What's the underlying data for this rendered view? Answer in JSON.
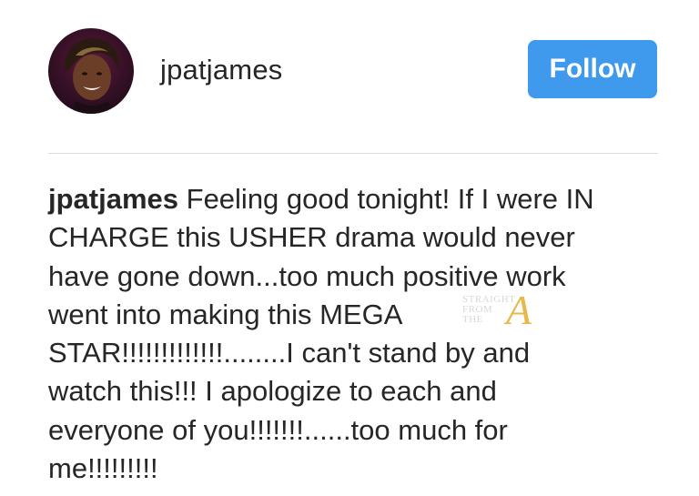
{
  "post_header": {
    "username": "jpatjames",
    "follow_label": "Follow"
  },
  "caption": {
    "username": "jpatjames",
    "lines": [
      " Feeling good tonight! If I were IN",
      "CHARGE this USHER drama would never",
      "have gone down...too much positive work",
      "went into making this MEGA",
      "STAR!!!!!!!!!!!!!........I can't stand by and",
      "watch this!!! I apologize to each and",
      "everyone of you!!!!!!!......too much for",
      "me!!!!!!!!!"
    ]
  },
  "watermark": {
    "line1": "STRAIGHT",
    "line2": "FROM",
    "line3": "THE",
    "letter": "A"
  },
  "colors": {
    "follow_button": "#3f99ed",
    "text": "#262626",
    "divider": "#dbdbdb"
  }
}
